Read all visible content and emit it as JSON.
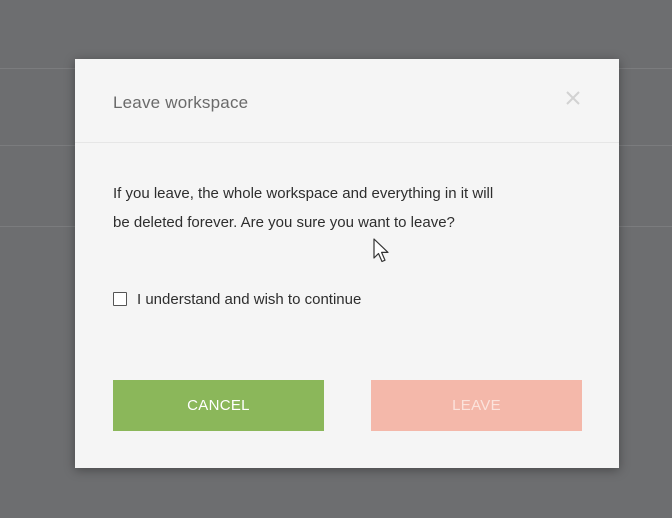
{
  "dialog": {
    "title": "Leave workspace",
    "close_icon": "close-icon",
    "message_line1": "If you leave, the whole workspace and everything in it will",
    "message_line2": "be deleted forever. Are you sure you want to leave?",
    "checkbox": {
      "label": "I understand and wish to continue",
      "checked": false
    },
    "cancel_label": "CANCEL",
    "leave_label": "LEAVE",
    "leave_enabled": false
  },
  "colors": {
    "overlay": "#6d6e70",
    "cancel_button": "#8bb75a",
    "leave_button_disabled": "#f4b8aa",
    "dialog_background": "#f5f5f5"
  },
  "icons": {
    "close": "close-icon",
    "checkbox": "checkbox-icon",
    "cursor": "mouse-pointer-icon"
  }
}
